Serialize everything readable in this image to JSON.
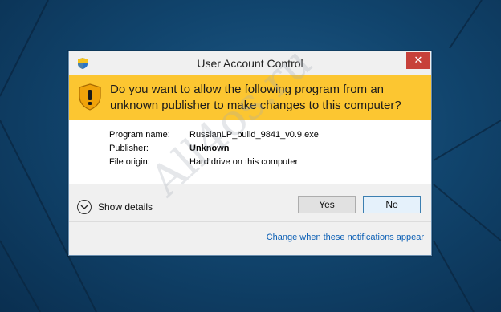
{
  "dialog": {
    "title": "User Account Control",
    "close_label": "✕",
    "question": "Do you want to allow the following program from an unknown publisher to make changes to this computer?",
    "details": [
      {
        "label": "Program name:",
        "value": "RussianLP_build_9841_v0.9.exe"
      },
      {
        "label": "Publisher:",
        "value": "Unknown"
      },
      {
        "label": "File origin:",
        "value": "Hard drive on this computer"
      }
    ],
    "show_details_label": "Show details",
    "yes_label": "Yes",
    "no_label": "No",
    "notifications_link": "Change when these notifications appear"
  },
  "watermark": "All4os.ru",
  "icons": {
    "title": "uac-shield-icon",
    "banner": "warning-shield-icon",
    "details": "chevron-down-icon",
    "close": "close-icon"
  },
  "colors": {
    "banner": "#fcc631",
    "close": "#c7413a",
    "link": "#0b5fb5",
    "desktop": "#11456e"
  }
}
